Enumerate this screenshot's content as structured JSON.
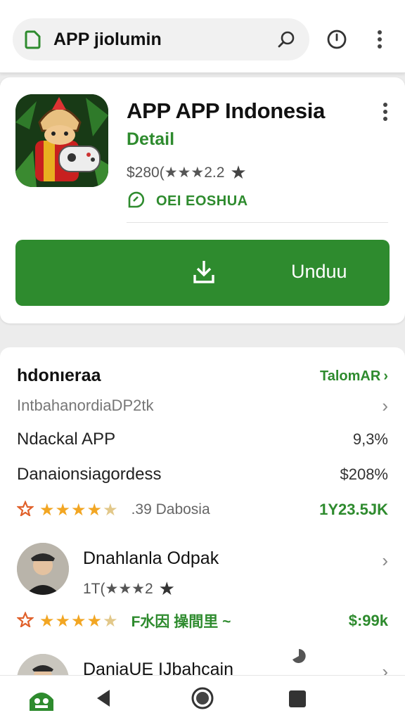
{
  "search": {
    "text": "APP jiolumin"
  },
  "icons": {
    "tag": "tag-icon",
    "search": "search-icon",
    "history": "history-icon",
    "menu": "more-vert-icon",
    "download": "download-icon",
    "developer": "developer-badge-icon",
    "chevron": "chevron-right-icon",
    "home": "home-icon",
    "back": "back-icon",
    "circle": "home-circle-icon",
    "square": "recents-icon"
  },
  "app": {
    "title": "APP APP Indonesia",
    "subtitle": "Detail",
    "rating_text": "$280(★★★2.2",
    "rating_star": "★",
    "developer": "OEI EOSHUA",
    "install_label": "Unduu"
  },
  "section": {
    "title": "hdonıeraa",
    "more": "TalomAR",
    "more_chevron": "›"
  },
  "rows": [
    {
      "label": "IntbahanordiaDP2tk",
      "value": "›"
    },
    {
      "label": "Ndackal APP",
      "value": "9,3%"
    },
    {
      "label": "Danaionsiagordess",
      "value": "$208%"
    }
  ],
  "rating_row": {
    "stars_on": "★★★★",
    "stars_off": "★",
    "note": ".39 Dabosia",
    "value": "1Y23.5JK"
  },
  "reviews": [
    {
      "name": "Dnahlanla Odpak",
      "rating_text": "1T(★★★2",
      "rating_star": "★",
      "chevron": "›"
    },
    {
      "name": "DaniaUE IJbahcain",
      "chevron": "›"
    }
  ],
  "review_stars_row": {
    "stars_on": "★★★★",
    "stars_off": "★",
    "note": "F水因 操間里 ~",
    "value": "$:99k"
  },
  "colors": {
    "accent": "#2e8b2e",
    "star": "#f2a623"
  }
}
